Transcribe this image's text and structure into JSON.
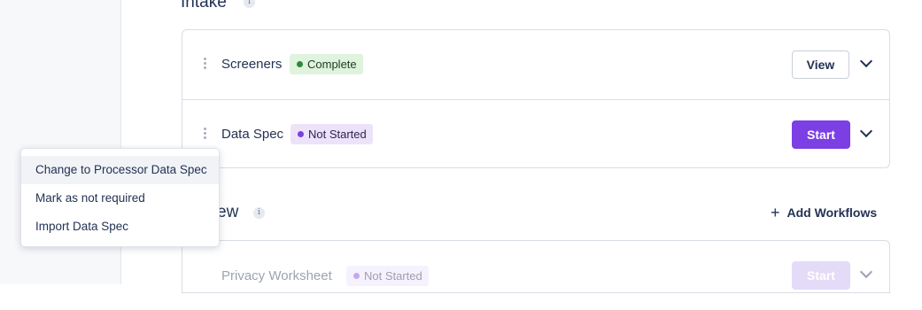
{
  "sections": {
    "intake": {
      "title": "Intake",
      "info": "i"
    },
    "review": {
      "title_fragment": "ew",
      "info": "i",
      "add_workflows_icon": "+",
      "add_workflows_label": "Add Workflows"
    }
  },
  "rows": [
    {
      "label": "Screeners",
      "status": "Complete",
      "status_color": "#2c8a3a",
      "action": "View"
    },
    {
      "label": "Data Spec",
      "status": "Not Started",
      "status_color": "#7a3fe0",
      "action": "Start"
    },
    {
      "label": "Privacy Worksheet",
      "status": "Not Started",
      "status_color": "#7a3fe0",
      "action": "Start"
    }
  ],
  "context_menu": {
    "items": [
      "Change to Processor Data Spec",
      "Mark as not required",
      "Import Data Spec"
    ]
  },
  "colors": {
    "accent": "#7b3fe4",
    "text": "#233354"
  }
}
